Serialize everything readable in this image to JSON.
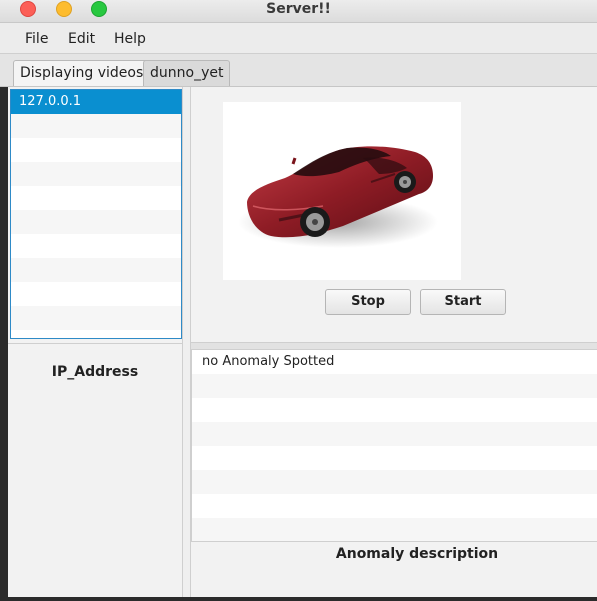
{
  "window": {
    "title": "Server!!"
  },
  "menu": {
    "items": [
      "File",
      "Edit",
      "Help"
    ]
  },
  "tabs": [
    {
      "label": "Displaying videos",
      "active": true
    },
    {
      "label": "dunno_yet",
      "active": false
    }
  ],
  "ip_list": {
    "items": [
      "127.0.0.1",
      "",
      "",
      "",
      "",
      "",
      "",
      "",
      "",
      ""
    ],
    "selected_index": 0,
    "label": "IP_Address"
  },
  "video": {
    "image": "red-sports-car"
  },
  "controls": {
    "stop_label": "Stop",
    "start_label": "Start"
  },
  "anomalies": {
    "items": [
      "no Anomaly Spotted",
      "",
      "",
      "",
      "",
      "",
      "",
      ""
    ],
    "label": "Anomaly description"
  },
  "colors": {
    "selection": "#0a8fd0",
    "list_border": "#2e8ac7"
  }
}
